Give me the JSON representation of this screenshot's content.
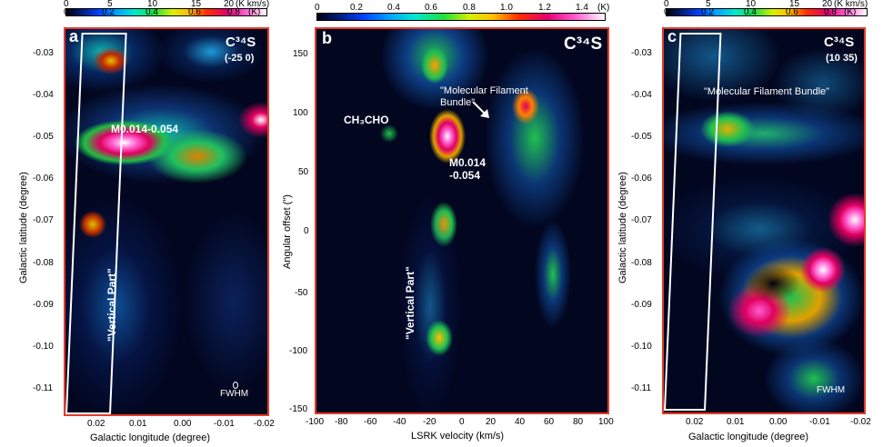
{
  "panel_a": {
    "letter": "a",
    "colorbar": {
      "top_ticks": [
        "0",
        "5",
        "10",
        "15",
        "20"
      ],
      "top_unit": "(K km/s)",
      "bottom_ticks": [
        "0",
        "0.2",
        "0.4",
        "0.6",
        "0.8"
      ],
      "bottom_unit": "(K)"
    },
    "molecule": "C³⁴S",
    "velocity_range": "(-25 0)",
    "y_ticks": [
      "-0.03",
      "-0.04",
      "-0.05",
      "-0.06",
      "-0.07",
      "-0.08",
      "-0.09",
      "-0.10",
      "-0.11"
    ],
    "x_ticks": [
      "0.02",
      "0.01",
      "0.00",
      "-0.01",
      "-0.02"
    ],
    "x_label": "Galactic longitude (degree)",
    "y_label": "Galactic latitude (degree)",
    "label_source": "M0.014-0.054",
    "label_vertical": "\"Vertical Part\"",
    "label_fwhm": "FWHM"
  },
  "panel_b": {
    "letter": "b",
    "colorbar": {
      "ticks": [
        "0",
        "0.2",
        "0.4",
        "0.6",
        "0.8",
        "1.0",
        "1.2",
        "1.4"
      ],
      "unit": "(K)"
    },
    "molecule": "C³⁴S",
    "y_ticks": [
      "150",
      "100",
      "50",
      "0",
      "-50",
      "-100",
      "-150"
    ],
    "x_ticks": [
      "-100",
      "-80",
      "-60",
      "-40",
      "-20",
      "0",
      "20",
      "40",
      "60",
      "80",
      "100"
    ],
    "x_label": "LSRK velocity (km/s)",
    "y_label": "Angular offset (\")",
    "label_ch3cho": "CH₃CHO",
    "label_filament_1": "\"Molecular Filament",
    "label_filament_2": "Bundle\"",
    "label_source_1": "M0.014",
    "label_source_2": "-0.054",
    "label_vertical": "\"Vertical Part\""
  },
  "panel_c": {
    "letter": "c",
    "colorbar": {
      "top_ticks": [
        "0",
        "5",
        "10",
        "15",
        "20"
      ],
      "top_unit": "(K km/s)",
      "bottom_ticks": [
        "0",
        "0.2",
        "0.4",
        "0.6",
        "0.8"
      ],
      "bottom_unit": "(K)"
    },
    "molecule": "C³⁴S",
    "velocity_range": "(10 35)",
    "y_ticks": [
      "-0.03",
      "-0.04",
      "-0.05",
      "-0.06",
      "-0.07",
      "-0.08",
      "-0.09",
      "-0.10",
      "-0.11"
    ],
    "x_ticks": [
      "0.02",
      "0.01",
      "0.00",
      "-0.01",
      "-0.02"
    ],
    "x_label": "Galactic longitude (degree)",
    "y_label": "Galactic latitude (degree)",
    "label_filament": "\"Molecular Filament Bundle\"",
    "label_fwhm": "FWHM"
  }
}
